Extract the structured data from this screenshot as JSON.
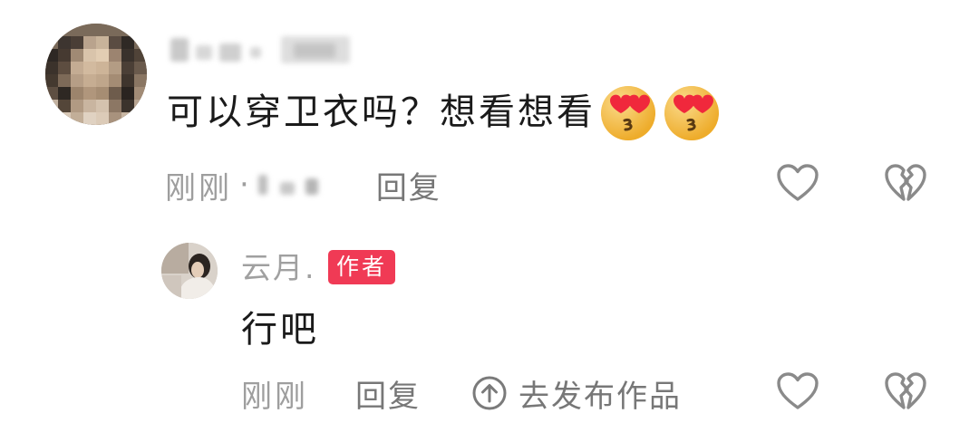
{
  "comment": {
    "text": "可以穿卫衣吗？想看想看",
    "emojis": [
      "heart-eyes-kiss-emoji",
      "heart-eyes-kiss-emoji"
    ],
    "time": "刚刚",
    "separator": "·",
    "reply_label": "回复"
  },
  "reply": {
    "author": "云月.",
    "badge": "作者",
    "text": "行吧",
    "time": "刚刚",
    "reply_label": "回复",
    "publish_label": "去发布作品"
  },
  "icons": {
    "like": "heart-outline-icon",
    "dislike": "broken-heart-outline-icon",
    "publish": "arrow-up-circle-icon"
  },
  "colors": {
    "badge": "#f03a55",
    "muted_text": "#9e9e9e",
    "icon_stroke": "#8a8a8a"
  }
}
